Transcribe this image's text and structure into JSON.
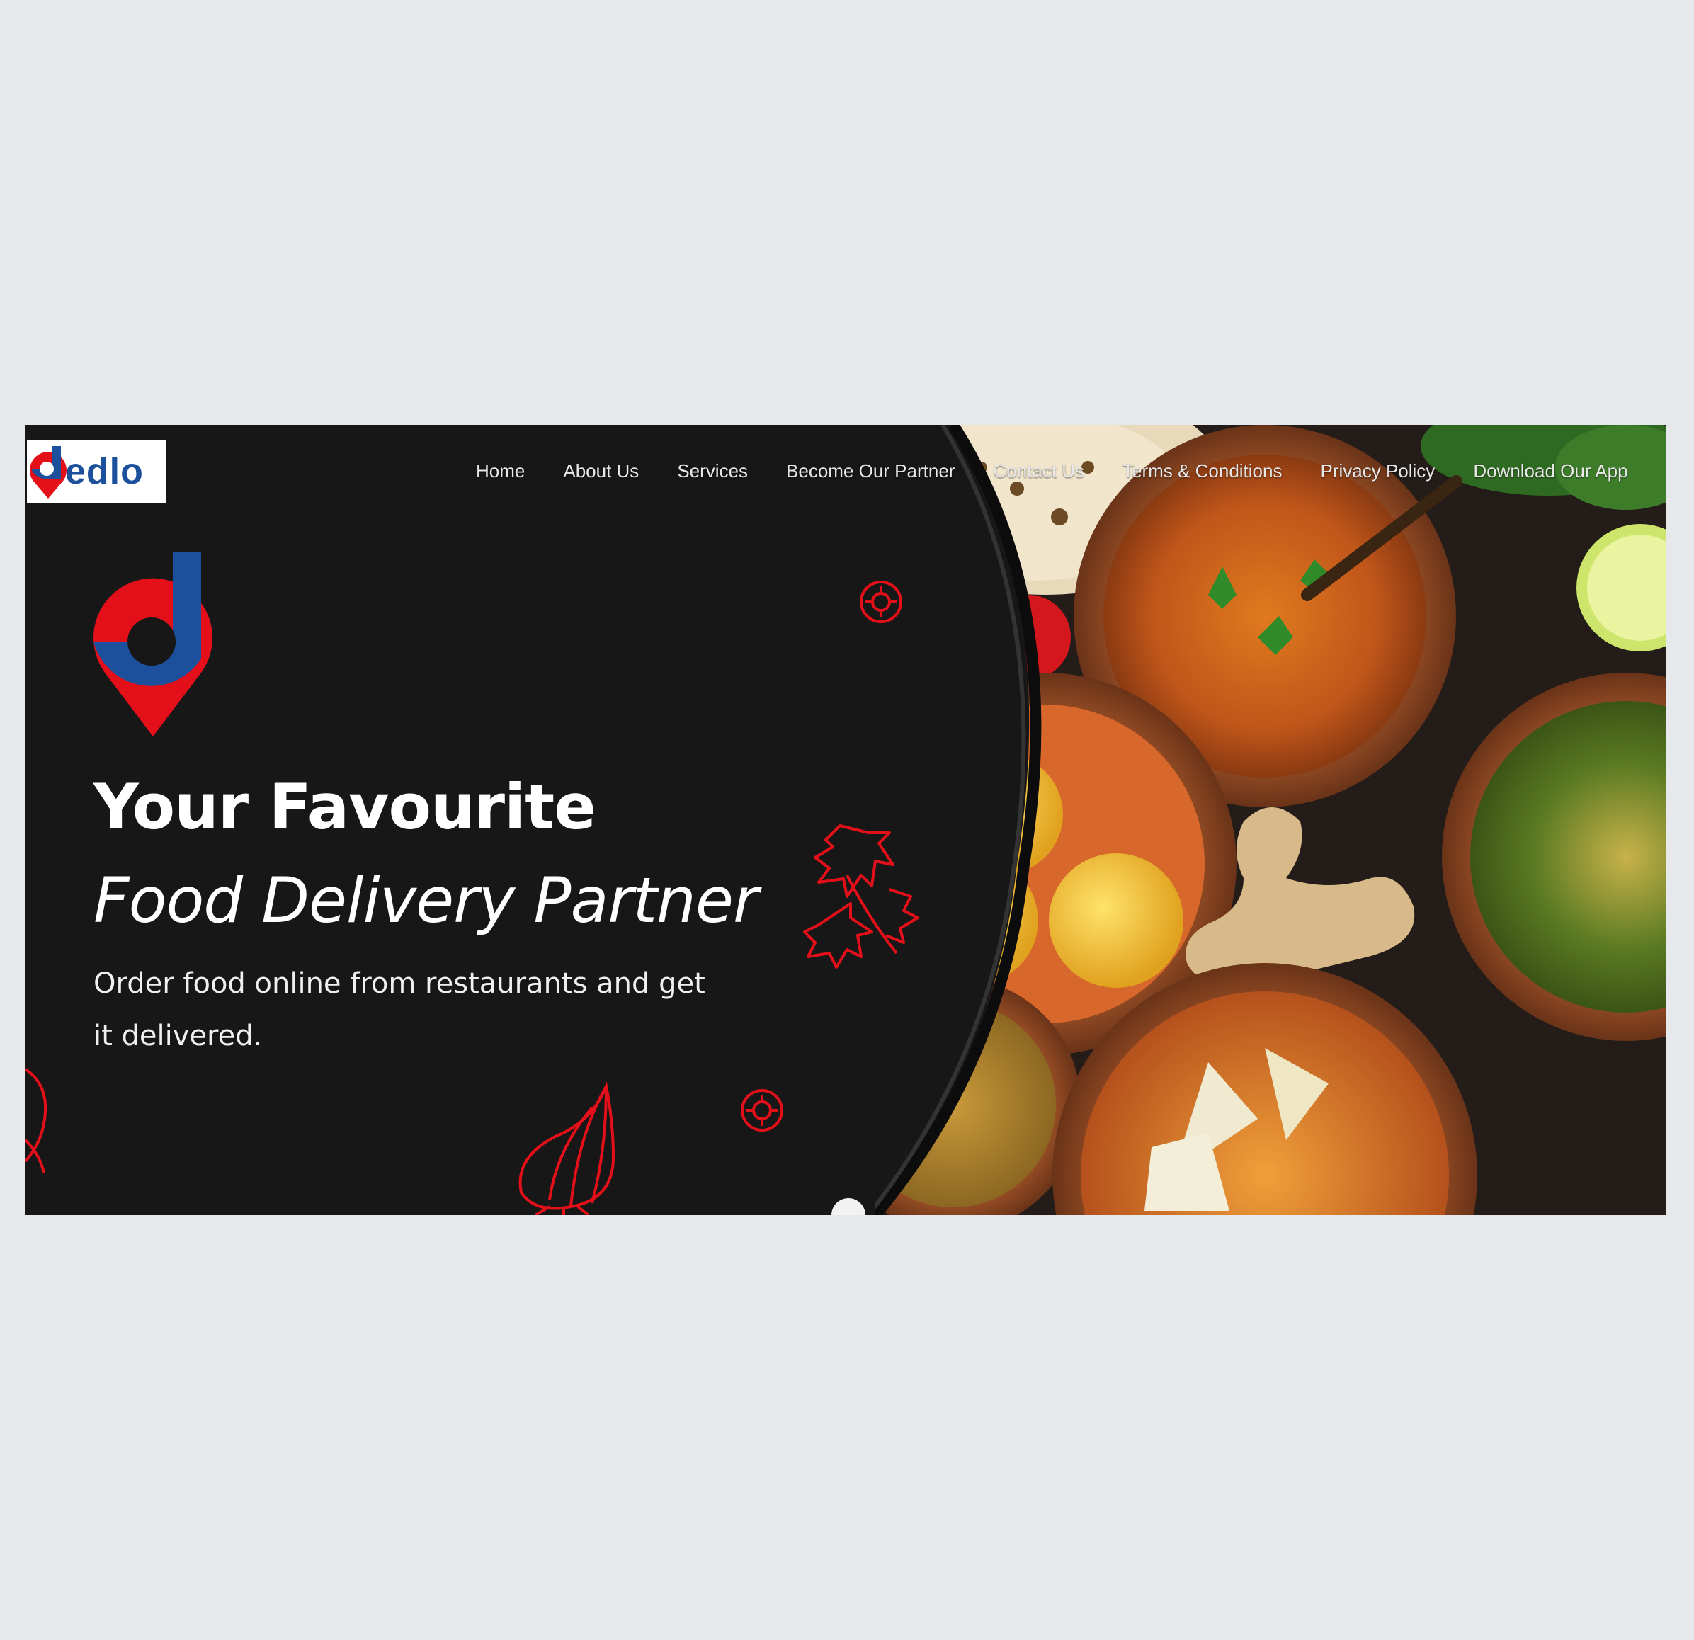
{
  "brand": {
    "wordmark": "edlo",
    "colors": {
      "red": "#e3101a",
      "blue": "#1c4f9c",
      "background": "#171717"
    }
  },
  "nav": {
    "items": [
      {
        "label": "Home"
      },
      {
        "label": "About Us"
      },
      {
        "label": "Services"
      },
      {
        "label": "Become Our Partner"
      },
      {
        "label": "Contact Us"
      },
      {
        "label": "Terms & Conditions"
      },
      {
        "label": "Privacy Policy"
      },
      {
        "label": "Download Our App"
      }
    ]
  },
  "hero": {
    "title_line1": "Your Favourite",
    "title_line2": "Food Delivery Partner",
    "subtitle": "Order food online from restaurants and get it delivered."
  },
  "icons": {
    "doodles": [
      "gear-doodle-icon",
      "cilantro-doodle-icon",
      "onion-doodle-icon",
      "chili-doodle-icon"
    ]
  }
}
